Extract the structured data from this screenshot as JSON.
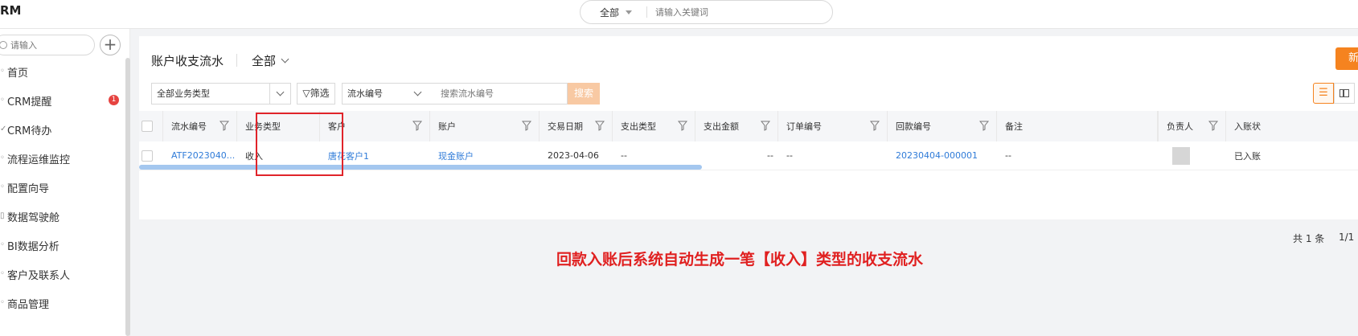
{
  "app": {
    "brand": "RM"
  },
  "global_search": {
    "scope": "全部",
    "placeholder": "请输入关键词"
  },
  "sidebar": {
    "search_placeholder": "请输入",
    "add_label": "+",
    "items": [
      {
        "label": "首页"
      },
      {
        "label": "CRM提醒",
        "badge": "1"
      },
      {
        "label": "CRM待办"
      },
      {
        "label": "流程运维监控"
      },
      {
        "label": "配置向导"
      },
      {
        "label": "数据驾驶舱"
      },
      {
        "label": "BI数据分析"
      },
      {
        "label": "客户及联系人"
      },
      {
        "label": "商品管理"
      }
    ]
  },
  "page": {
    "title": "账户收支流水",
    "scope": "全部",
    "new_button": "新"
  },
  "filters": {
    "type_select": "全部业务类型",
    "filter_button": "筛选",
    "field_select": "流水编号",
    "keyword_placeholder": "搜索流水编号",
    "search_button": "搜索"
  },
  "table": {
    "columns": [
      "流水编号",
      "业务类型",
      "客户",
      "账户",
      "交易日期",
      "支出类型",
      "支出金额",
      "订单编号",
      "回款编号",
      "备注",
      "负责人",
      "入账状"
    ],
    "rows": [
      {
        "serial": "ATF2023040...",
        "type": "收入",
        "customer": "唐花客户1",
        "account": "现金账户",
        "date": "2023-04-06",
        "expense_type": "--",
        "expense_amount": "--",
        "order_no": "--",
        "payment_no": "20230404-000001",
        "remark": "--",
        "status": "已入账"
      }
    ]
  },
  "pager": {
    "total": "共 1 条",
    "pages": "1/1"
  },
  "annotation": "回款入账后系统自动生成一笔【收入】类型的收支流水",
  "colors": {
    "accent": "#f5831f",
    "link": "#2f7bd8",
    "highlight": "#e0242a"
  }
}
